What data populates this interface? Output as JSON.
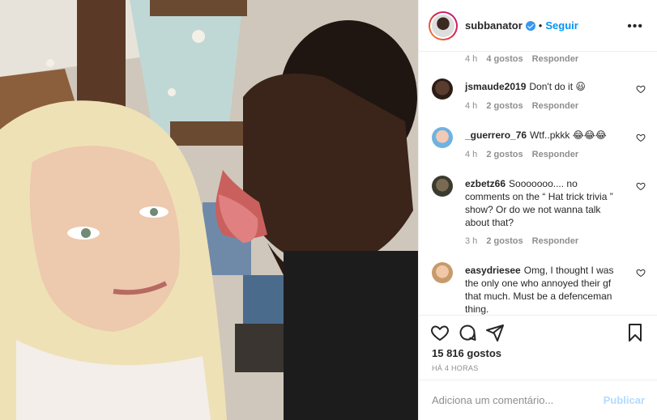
{
  "post": {
    "username": "subbanator",
    "follow_label": "Seguir",
    "more_label": "•••"
  },
  "comments_top_meta": {
    "time": "4 h",
    "likes": "4 gostos",
    "reply": "Responder"
  },
  "comments": [
    {
      "username": "jsmaude2019",
      "text": "Don't do it 😃",
      "time": "4 h",
      "likes": "2 gostos",
      "reply": "Responder"
    },
    {
      "username": "_guerrero_76",
      "text": "Wtf..pkkk 😂😂😂",
      "time": "4 h",
      "likes": "2 gostos",
      "reply": "Responder"
    },
    {
      "username": "ezbetz66",
      "text": "Sooooooo.... no comments on the “ Hat trick trivia ” show? Or do we not wanna talk about that?",
      "time": "3 h",
      "likes": "2 gostos",
      "reply": "Responder"
    },
    {
      "username": "easydriesee",
      "text": "Omg, I thought I was the only one who annoyed their gf that much. Must be a defenceman thing.",
      "time": "",
      "likes": "",
      "reply": ""
    }
  ],
  "actions": {
    "like_icon": "heart-outline-icon",
    "comment_icon": "comment-bubble-icon",
    "share_icon": "paper-plane-icon",
    "save_icon": "bookmark-icon"
  },
  "likes_count": "15 816 gostos",
  "timestamp": "HÁ 4 HORAS",
  "add_comment": {
    "placeholder": "Adiciona um comentário...",
    "post_label": "Publicar"
  },
  "colors": {
    "accent": "#0095f6",
    "verified": "#3897f0",
    "muted": "#8e8e8e",
    "publish_disabled": "#b3dbff"
  }
}
